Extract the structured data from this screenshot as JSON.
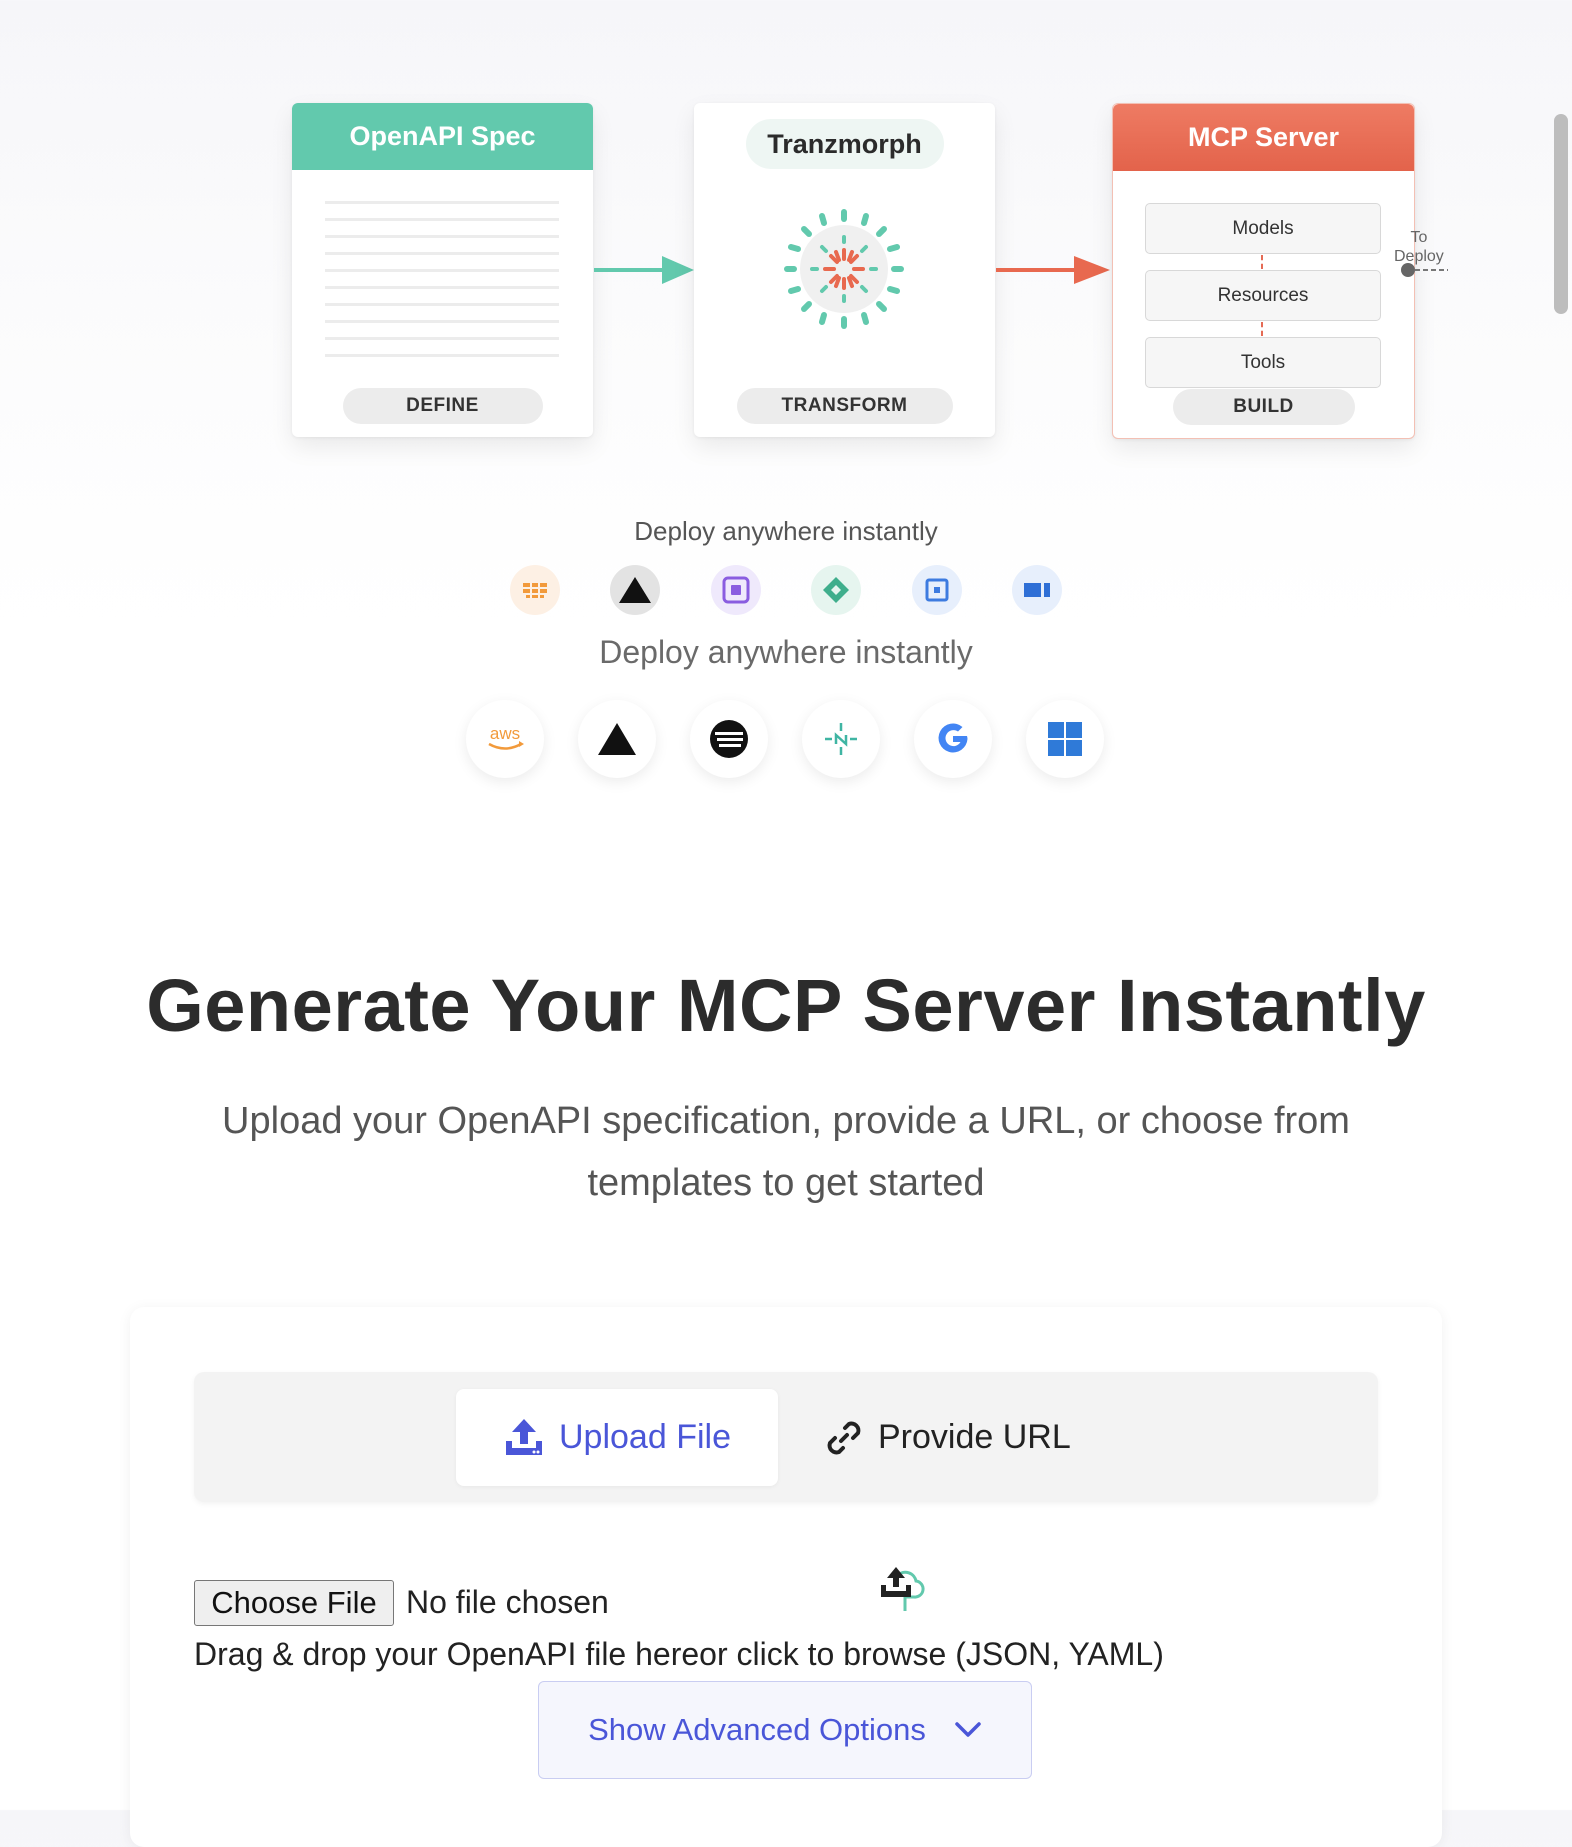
{
  "pipeline": {
    "spec": {
      "title": "OpenAPI Spec",
      "stage": "DEFINE"
    },
    "transform": {
      "title": "Tranzmorph",
      "stage": "TRANSFORM"
    },
    "mcp": {
      "title": "MCP Server",
      "items": [
        "Models",
        "Resources",
        "Tools"
      ],
      "stage": "BUILD"
    },
    "deploy_label_line1": "To",
    "deploy_label_line2": "Deploy",
    "colors": {
      "spec": "#62c9ad",
      "mcp": "#e8694f",
      "arrow_teal": "#62c9ad",
      "arrow_orange": "#e8694f"
    }
  },
  "deploy": {
    "caption_small": "Deploy anywhere instantly",
    "small_icons": [
      "cloudflare-icon",
      "vercel-icon",
      "server-box-icon",
      "diamond-icon",
      "square-box-icon",
      "azure-icon"
    ],
    "caption_large": "Deploy anywhere instantly",
    "large_icons": [
      "aws-icon",
      "vercel-icon",
      "digitalocean-icon",
      "netlify-icon",
      "google-icon",
      "windows-icon"
    ],
    "aws_text": "aws"
  },
  "hero": {
    "title": "Generate Your MCP Server Instantly",
    "subtitle": "Upload your OpenAPI specification, provide a URL, or choose from templates to get started"
  },
  "upload": {
    "tabs": {
      "upload": "Upload File",
      "url": "Provide URL"
    },
    "file_button": "Choose File",
    "file_status": "No file chosen",
    "drag_text": "Drag & drop your OpenAPI file hereor click to browse (JSON, YAML)",
    "advanced_label": "Show Advanced Options",
    "accent": "#4a56d8"
  }
}
